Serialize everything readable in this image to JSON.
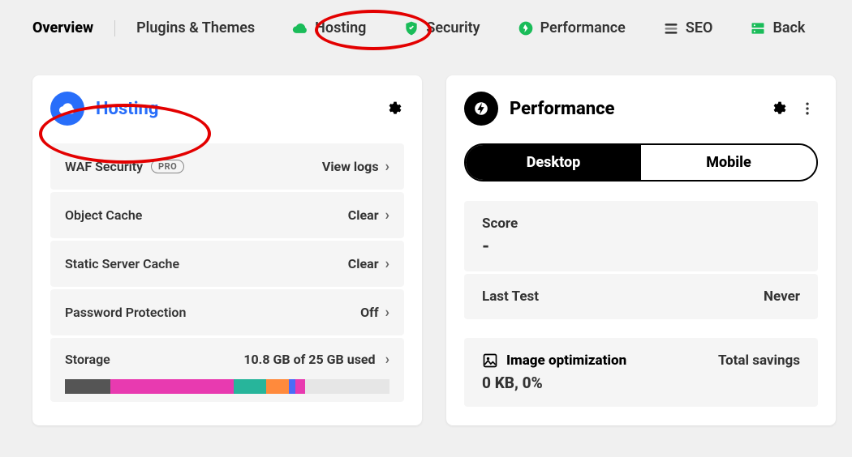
{
  "nav": {
    "overview": "Overview",
    "plugins": "Plugins & Themes",
    "hosting": "Hosting",
    "security": "Security",
    "performance": "Performance",
    "seo": "SEO",
    "backups": "Back"
  },
  "hosting": {
    "title": "Hosting",
    "items": [
      {
        "label": "WAF Security",
        "badge": "PRO",
        "action": "View logs"
      },
      {
        "label": "Object Cache",
        "action": "Clear"
      },
      {
        "label": "Static Server Cache",
        "action": "Clear"
      },
      {
        "label": "Password Protection",
        "action": "Off"
      }
    ],
    "storage": {
      "label": "Storage",
      "text": "10.8 GB of 25 GB used",
      "segments": [
        {
          "color": "#555555",
          "width": 14
        },
        {
          "color": "#e83ab0",
          "width": 38
        },
        {
          "color": "#27b59b",
          "width": 10
        },
        {
          "color": "#ff8a3c",
          "width": 7
        },
        {
          "color": "#4a6cf7",
          "width": 2
        },
        {
          "color": "#e83ab0",
          "width": 3
        },
        {
          "color": "#e6e6e6",
          "width": 26
        }
      ]
    }
  },
  "performance": {
    "title": "Performance",
    "tabs": {
      "desktop": "Desktop",
      "mobile": "Mobile"
    },
    "score_label": "Score",
    "score_value": "-",
    "last_test_label": "Last Test",
    "last_test_value": "Never",
    "image_opt_label": "Image optimization",
    "total_savings_label": "Total savings",
    "image_opt_value": "0 KB, 0%"
  }
}
